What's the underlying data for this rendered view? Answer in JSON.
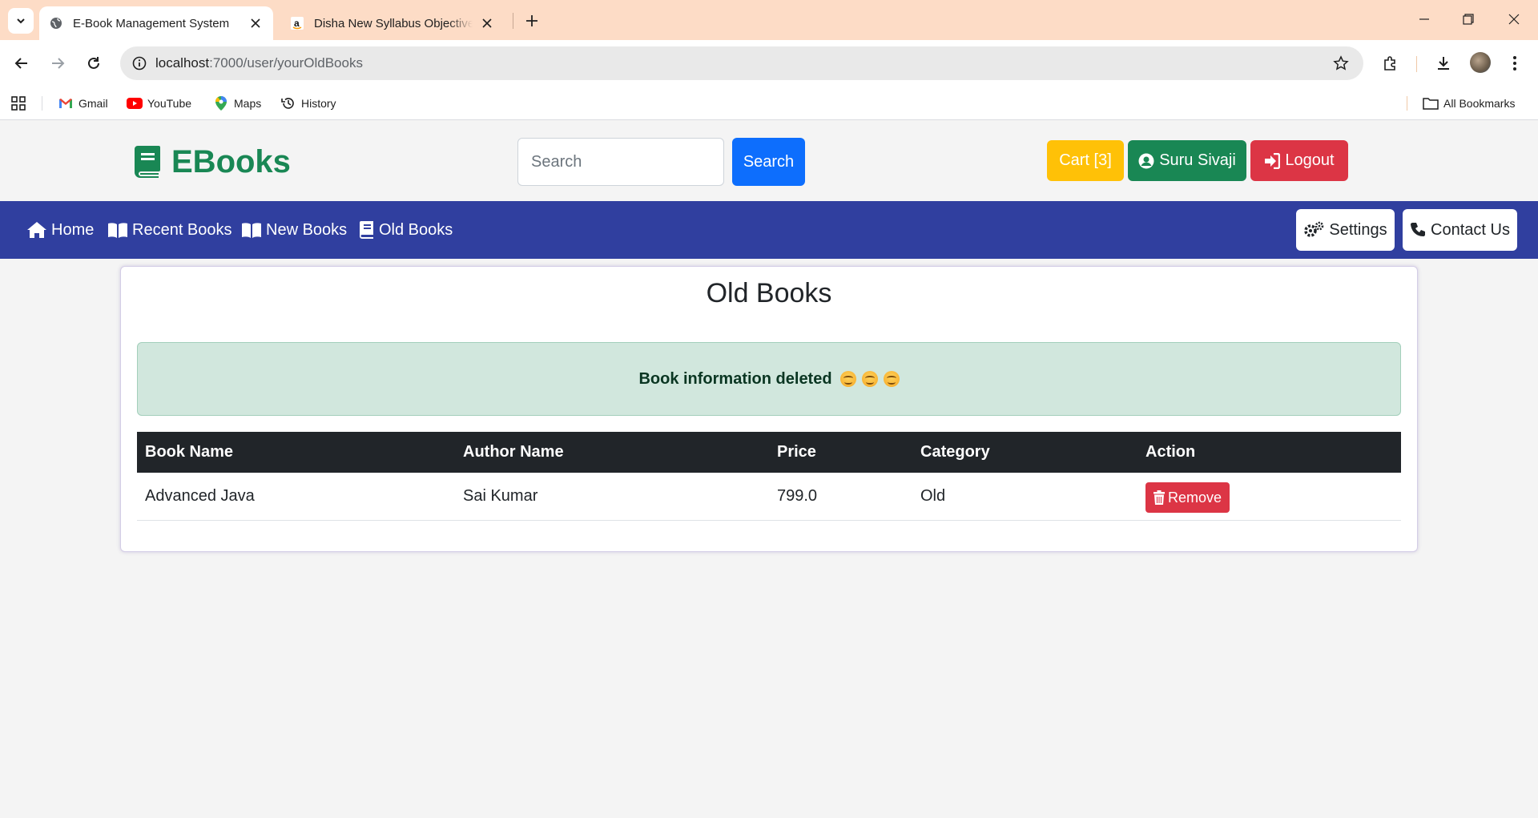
{
  "browser": {
    "tabs": [
      {
        "title": "E-Book Management System",
        "active": true
      },
      {
        "title": "Disha New Syllabus Objective NEET",
        "active": false
      }
    ],
    "url_host": "localhost",
    "url_path": ":7000/user/yourOldBooks",
    "bookmarks": [
      {
        "label": "Gmail",
        "icon": "gmail-icon"
      },
      {
        "label": "YouTube",
        "icon": "youtube-icon"
      },
      {
        "label": "Maps",
        "icon": "maps-icon"
      },
      {
        "label": "History",
        "icon": "history-icon"
      }
    ],
    "all_bookmarks_label": "All Bookmarks"
  },
  "header": {
    "logo_text": "EBooks",
    "search_placeholder": "Search",
    "search_button": "Search",
    "cart_label": "Cart [3]",
    "user_label": "Suru Sivaji",
    "logout_label": "Logout"
  },
  "nav": {
    "links": [
      "Home",
      "Recent Books",
      "New Books",
      "Old Books"
    ],
    "settings_label": "Settings",
    "contact_label": "Contact Us"
  },
  "main": {
    "title": "Old Books",
    "alert_text": "Book information deleted",
    "table": {
      "headers": [
        "Book Name",
        "Author Name",
        "Price",
        "Category",
        "Action"
      ],
      "rows": [
        {
          "book_name": "Advanced Java",
          "author": "Sai Kumar",
          "price": "799.0",
          "category": "Old",
          "action": "Remove"
        }
      ]
    }
  },
  "colors": {
    "brand_green": "#198754",
    "nav_blue": "#303f9f",
    "search_blue": "#0d6efd",
    "cart_yellow": "#ffc107",
    "danger_red": "#dc3545",
    "tabbar_peach": "#fddcc6"
  }
}
